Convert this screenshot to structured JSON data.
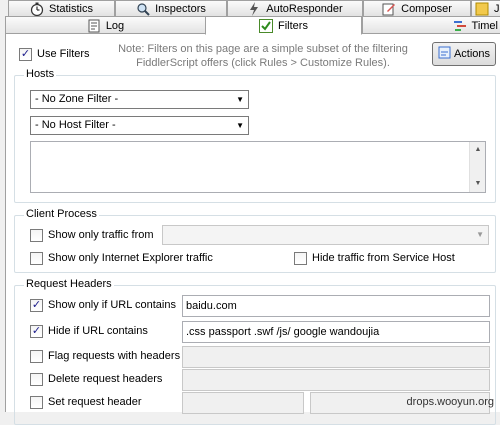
{
  "tabs_row1": [
    {
      "label": "Statistics",
      "icon": "stopwatch-icon"
    },
    {
      "label": "Inspectors",
      "icon": "inspectors-icon"
    },
    {
      "label": "AutoResponder",
      "icon": "lightning-icon"
    },
    {
      "label": "Composer",
      "icon": "composer-icon"
    },
    {
      "label": "J",
      "icon": "script-icon"
    }
  ],
  "tabs_row2": [
    {
      "label": "Log",
      "icon": "log-icon"
    },
    {
      "label": "Filters",
      "icon": "filter-check-icon"
    },
    {
      "label": "Timel",
      "icon": "timeline-icon"
    }
  ],
  "use_filters": {
    "label": "Use Filters",
    "checked": true
  },
  "note": {
    "line1": "Note: Filters on this page are a simple subset of the filtering",
    "line2": "FiddlerScript offers (click Rules > Customize Rules)."
  },
  "actions_button": {
    "label": "Actions"
  },
  "hosts": {
    "title": "Hosts",
    "zone_filter": "- No Zone Filter -",
    "host_filter": "- No Host Filter -",
    "hosts_list": ""
  },
  "client_process": {
    "title": "Client Process",
    "show_only_traffic_from": {
      "label": "Show only traffic from",
      "checked": false,
      "value": ""
    },
    "show_only_ie": {
      "label": "Show only Internet Explorer traffic",
      "checked": false
    },
    "hide_service_host": {
      "label": "Hide traffic from Service Host",
      "checked": false
    }
  },
  "request_headers": {
    "title": "Request Headers",
    "show_only_url": {
      "label": "Show only if URL contains",
      "checked": true,
      "value": "baidu.com"
    },
    "hide_url": {
      "label": "Hide if URL contains",
      "checked": true,
      "value": ".css passport .swf /js/ google wandoujia"
    },
    "flag_headers": {
      "label": "Flag requests with headers",
      "checked": false,
      "value": ""
    },
    "delete_headers": {
      "label": "Delete request headers",
      "checked": false,
      "value": ""
    },
    "set_header": {
      "label": "Set request header",
      "checked": false,
      "name": "",
      "value": ""
    }
  },
  "watermark": "drops.wooyun.org"
}
